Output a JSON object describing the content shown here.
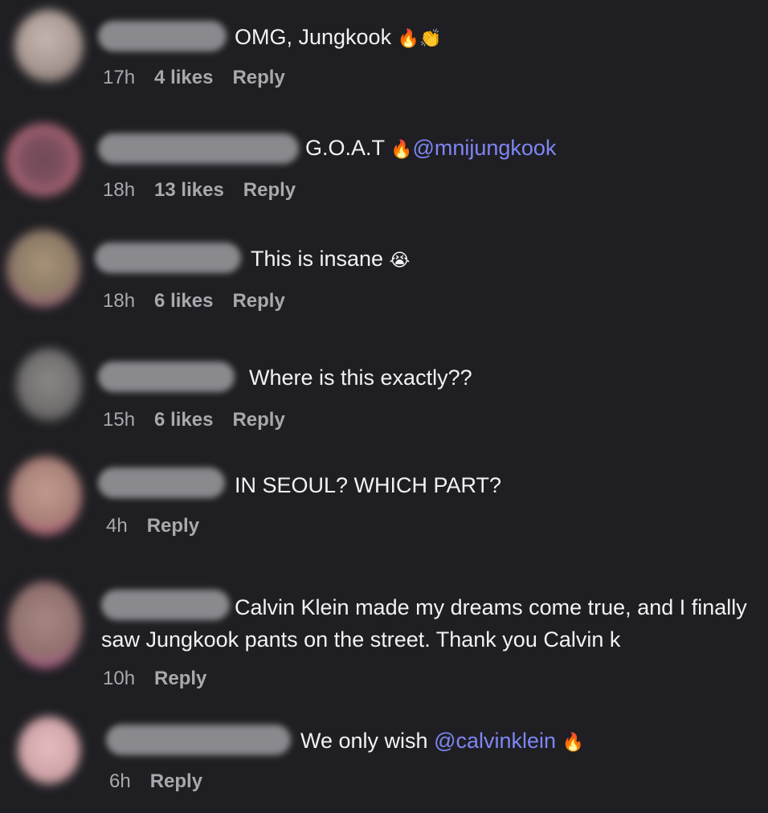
{
  "comments": [
    {
      "text": "OMG, Jungkook",
      "emojis": "🔥👏",
      "time": "17h",
      "likes": "4 likes",
      "reply": "Reply",
      "avatar_color": "#b7a6a1"
    },
    {
      "text": "G.O.A.T",
      "emojis": "🔥",
      "mention": "@mnijungkook",
      "time": "18h",
      "likes": "13 likes",
      "reply": "Reply",
      "avatar_color": "#8d5a6a"
    },
    {
      "text": "This is insane",
      "emojis": "😭",
      "time": "18h",
      "likes": "6 likes",
      "reply": "Reply",
      "avatar_color": "#9b8a6d"
    },
    {
      "text": "Where is this exactly??",
      "time": "15h",
      "likes": "6 likes",
      "reply": "Reply",
      "avatar_color": "#7c7a7a"
    },
    {
      "text": "IN SEOUL? WHICH PART?",
      "time": "4h",
      "reply": "Reply",
      "avatar_color": "#b28f87"
    },
    {
      "text": "Calvin Klein made my dreams come true, and I finally saw Jungkook pants on the street. Thank you Calvin k",
      "time": "10h",
      "reply": "Reply",
      "avatar_color": "#9f7e7b"
    },
    {
      "text": "We only wish",
      "mention": "@calvinklein",
      "emojis": "🔥",
      "time": "6h",
      "reply": "Reply",
      "avatar_color": "#d7aeb1"
    }
  ]
}
